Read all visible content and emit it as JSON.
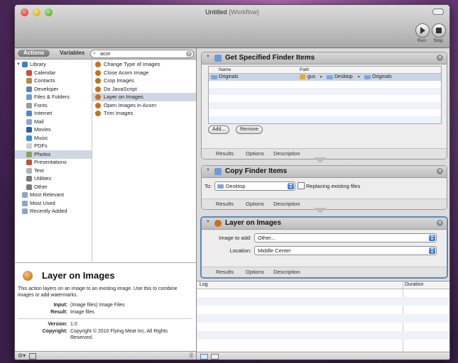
{
  "window": {
    "title": "Untitled",
    "title_suffix": "(Workflow)",
    "toolbar": {
      "run_label": "Run",
      "stop_label": "Stop"
    }
  },
  "left_pane": {
    "tabs": {
      "actions": "Actions",
      "variables": "Variables"
    },
    "search": {
      "value": "acor",
      "icon": "magnifier-icon"
    },
    "library": [
      {
        "label": "Library",
        "icon": "library-icon",
        "color": "#3f7fd0",
        "indent": 0,
        "expanded": true
      },
      {
        "label": "Calendar",
        "icon": "calendar-icon",
        "color": "#d9473a",
        "indent": 1
      },
      {
        "label": "Contacts",
        "icon": "contacts-icon",
        "color": "#b38a4a",
        "indent": 1
      },
      {
        "label": "Developer",
        "icon": "developer-icon",
        "color": "#5a82c7",
        "indent": 1
      },
      {
        "label": "Files & Folders",
        "icon": "finder-icon",
        "color": "#6e9bd6",
        "indent": 1
      },
      {
        "label": "Fonts",
        "icon": "fonts-icon",
        "color": "#9a9a9a",
        "indent": 1
      },
      {
        "label": "Internet",
        "icon": "internet-icon",
        "color": "#4a8ad0",
        "indent": 1
      },
      {
        "label": "Mail",
        "icon": "mail-icon",
        "color": "#8aa8cf",
        "indent": 1
      },
      {
        "label": "Movies",
        "icon": "movies-icon",
        "color": "#2f5ea8",
        "indent": 1
      },
      {
        "label": "Music",
        "icon": "music-icon",
        "color": "#3d8fd6",
        "indent": 1
      },
      {
        "label": "PDFs",
        "icon": "pdf-icon",
        "color": "#d0d0d0",
        "indent": 1
      },
      {
        "label": "Photos",
        "icon": "photos-icon",
        "color": "#88a35a",
        "indent": 1,
        "selected": true
      },
      {
        "label": "Presentations",
        "icon": "presentations-icon",
        "color": "#c2552f",
        "indent": 1
      },
      {
        "label": "Text",
        "icon": "text-icon",
        "color": "#b4b4b4",
        "indent": 1
      },
      {
        "label": "Utilities",
        "icon": "utilities-icon",
        "color": "#7a7a7a",
        "indent": 1
      },
      {
        "label": "Other",
        "icon": "other-icon",
        "color": "#7a7a7a",
        "indent": 1
      },
      {
        "label": "Most Relevant",
        "icon": "smart-folder-icon",
        "color": "#8aa6d0",
        "indent": 0
      },
      {
        "label": "Most Used",
        "icon": "smart-folder-icon",
        "color": "#8aa6d0",
        "indent": 0
      },
      {
        "label": "Recently Added",
        "icon": "smart-folder-icon",
        "color": "#8aa6d0",
        "indent": 0
      }
    ],
    "actions": [
      {
        "label": "Change Type of Images",
        "icon": "acorn-icon"
      },
      {
        "label": "Close Acorn Image",
        "icon": "acorn-icon"
      },
      {
        "label": "Crop Images",
        "icon": "acorn-icon"
      },
      {
        "label": "Do JavaScript",
        "icon": "acorn-icon"
      },
      {
        "label": "Layer on Images",
        "icon": "acorn-icon",
        "selected": true
      },
      {
        "label": "Open Images in Acorn",
        "icon": "acorn-icon"
      },
      {
        "label": "Trim Images",
        "icon": "acorn-icon"
      }
    ],
    "info": {
      "title": "Layer on Images",
      "description": "This action layers on an image to an existing image.  Use this to combine images or add watermarks.",
      "input_label": "Input:",
      "input_value": "(Image files) Image Files",
      "result_label": "Result:",
      "result_value": "Image files",
      "version_label": "Version:",
      "version_value": "1.0",
      "copyright_label": "Copyright:",
      "copyright_value": "Copyright © 2010 Flying Meat Inc, All Rights Reserved."
    }
  },
  "workflow": {
    "footer": {
      "results": "Results",
      "options": "Options",
      "description": "Description"
    },
    "get_items": {
      "title": "Get Specified Finder Items",
      "columns": {
        "name": "Name",
        "path": "Path"
      },
      "row": {
        "name": "Originals",
        "path": [
          "gus",
          "Desktop",
          "Originals"
        ],
        "sep": "▸"
      },
      "add_label": "Add...",
      "remove_label": "Remove"
    },
    "copy_items": {
      "title": "Copy Finder Items",
      "to_label": "To:",
      "to_value": "Desktop",
      "replace_label": "Replacing existing files",
      "replace_checked": false
    },
    "layer": {
      "title": "Layer on Images",
      "image_label": "Image to add:",
      "image_value": "Other...",
      "location_label": "Location:",
      "location_value": "Middle Center"
    }
  },
  "log": {
    "log_col": "Log",
    "duration_col": "Duration"
  },
  "colors": {
    "accent": "#5b87c8",
    "selection": "#cfd7e3",
    "acorn": "#c7711a"
  }
}
